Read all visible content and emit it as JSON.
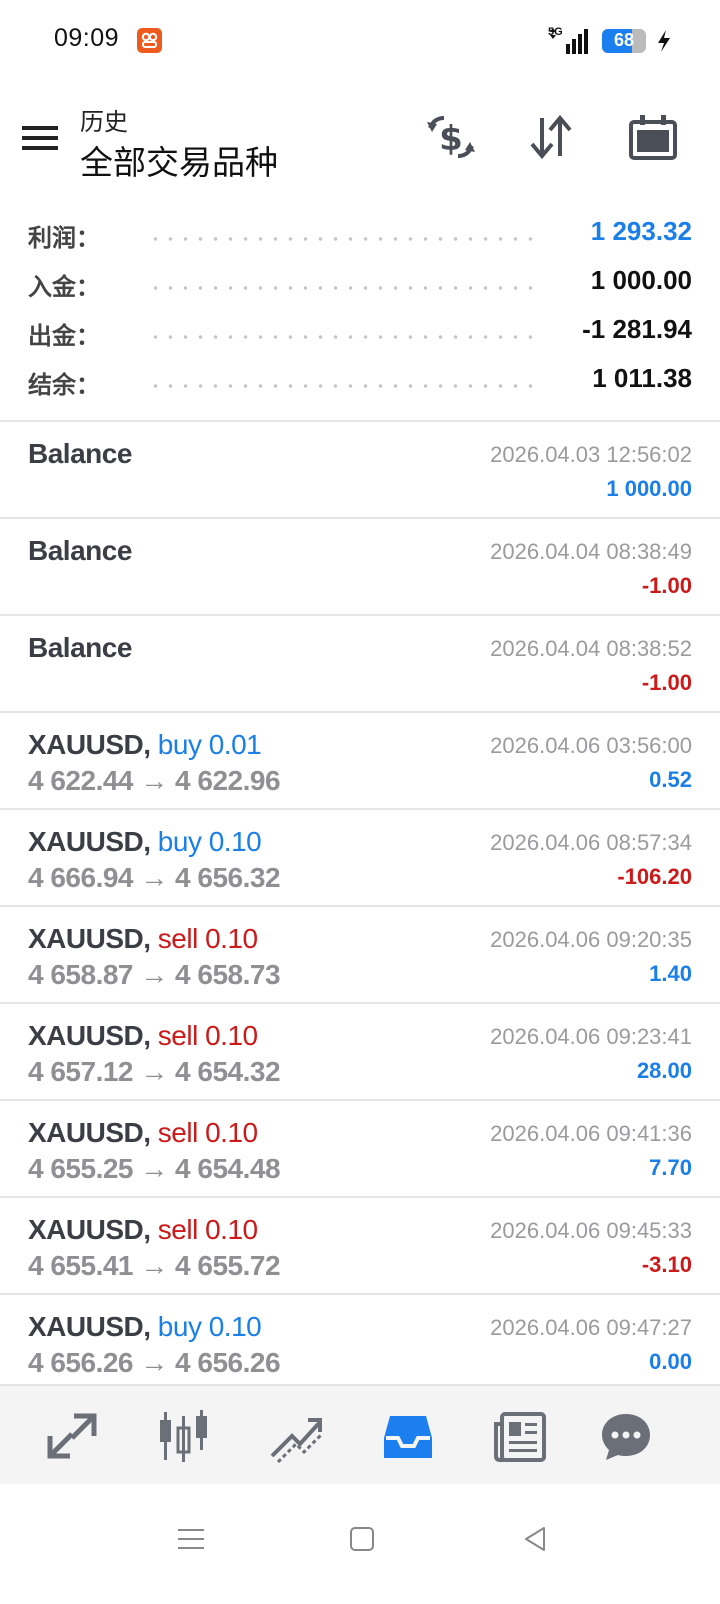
{
  "status_bar": {
    "time": "09:09",
    "network": "5G",
    "battery": "68",
    "battery_level": 0.68
  },
  "header": {
    "title_small": "历史",
    "title_big": "全部交易品种"
  },
  "summary": [
    {
      "label": "利润：",
      "value": "1 293.32",
      "tone": "pos"
    },
    {
      "label": "入金：",
      "value": "1 000.00",
      "tone": "neutral"
    },
    {
      "label": "出金：",
      "value": "-1 281.94",
      "tone": "neutral"
    },
    {
      "label": "结余：",
      "value": "1 011.38",
      "tone": "neutral"
    }
  ],
  "trades": [
    {
      "symbol": "Balance",
      "side": "",
      "prices": "",
      "time": "2026.04.03 12:56:02",
      "profit": "1 000.00",
      "tone": "pos"
    },
    {
      "symbol": "Balance",
      "side": "",
      "prices": "",
      "time": "2026.04.04 08:38:49",
      "profit": "-1.00",
      "tone": "neg"
    },
    {
      "symbol": "Balance",
      "side": "",
      "prices": "",
      "time": "2026.04.04 08:38:52",
      "profit": "-1.00",
      "tone": "neg"
    },
    {
      "symbol": "XAUUSD,",
      "side": "buy 0.01",
      "side_type": "buy",
      "prices": "4 622.44 → 4 622.96",
      "time": "2026.04.06 03:56:00",
      "profit": "0.52",
      "tone": "pos"
    },
    {
      "symbol": "XAUUSD,",
      "side": "buy 0.10",
      "side_type": "buy",
      "prices": "4 666.94 → 4 656.32",
      "time": "2026.04.06 08:57:34",
      "profit": "-106.20",
      "tone": "neg"
    },
    {
      "symbol": "XAUUSD,",
      "side": "sell 0.10",
      "side_type": "sell",
      "prices": "4 658.87 → 4 658.73",
      "time": "2026.04.06 09:20:35",
      "profit": "1.40",
      "tone": "pos"
    },
    {
      "symbol": "XAUUSD,",
      "side": "sell 0.10",
      "side_type": "sell",
      "prices": "4 657.12 → 4 654.32",
      "time": "2026.04.06 09:23:41",
      "profit": "28.00",
      "tone": "pos"
    },
    {
      "symbol": "XAUUSD,",
      "side": "sell 0.10",
      "side_type": "sell",
      "prices": "4 655.25 → 4 654.48",
      "time": "2026.04.06 09:41:36",
      "profit": "7.70",
      "tone": "pos"
    },
    {
      "symbol": "XAUUSD,",
      "side": "sell 0.10",
      "side_type": "sell",
      "prices": "4 655.41 → 4 655.72",
      "time": "2026.04.06 09:45:33",
      "profit": "-3.10",
      "tone": "neg"
    },
    {
      "symbol": "XAUUSD,",
      "side": "buy 0.10",
      "side_type": "buy",
      "prices": "4 656.26 → 4 656.26",
      "time": "2026.04.06 09:47:27",
      "profit": "0.00",
      "tone": "pos"
    }
  ],
  "header_icons": [
    "currency-exchange-icon",
    "sort-icon",
    "calendar-icon"
  ],
  "tab_icons": [
    "quotes-icon",
    "chart-icon",
    "trade-icon",
    "history-icon",
    "news-icon",
    "chat-icon"
  ],
  "active_tab": "history-icon",
  "colors": {
    "positive": "#1a7fe8",
    "negative": "#cc1a1a",
    "accent": "#1b7ff0",
    "icon": "#4a4f57"
  }
}
